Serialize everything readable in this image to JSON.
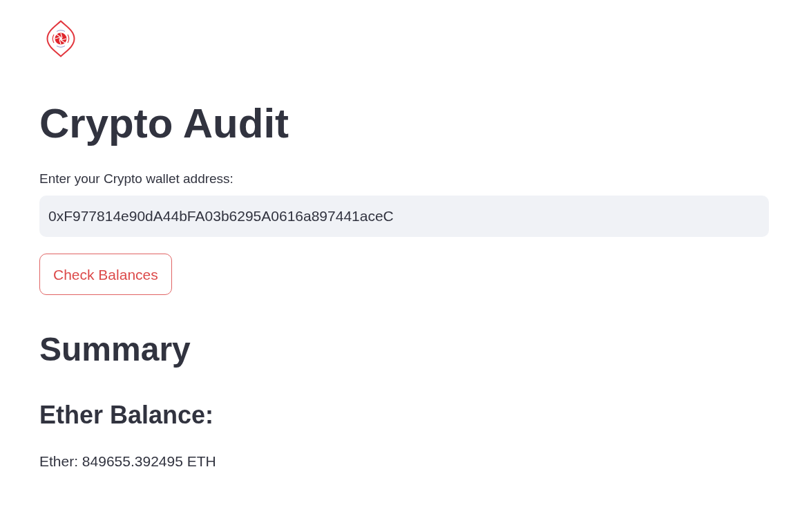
{
  "title": "Crypto Audit",
  "address_field": {
    "label": "Enter your Crypto wallet address:",
    "value": "0xF977814e90dA44bFA03b6295A0616a897441aceC"
  },
  "check_button": {
    "label": "Check Balances"
  },
  "summary": {
    "heading": "Summary",
    "sections": [
      {
        "heading": "Ether Balance:",
        "text": "Ether: 849655.392495 ETH"
      }
    ]
  }
}
